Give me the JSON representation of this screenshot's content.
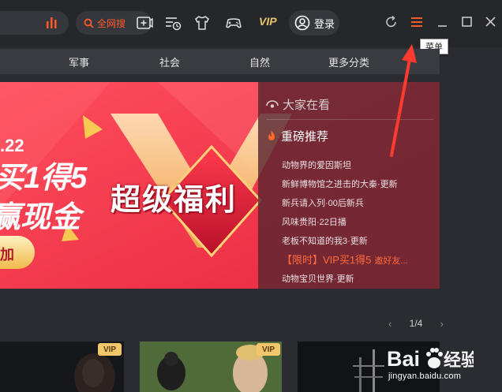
{
  "toolbar": {
    "search_all_label": "全网搜",
    "vip_label": "VIP",
    "login_label": "登录",
    "tooltip_menu": "菜单",
    "accent": "#ff5a2a"
  },
  "categories": [
    "军事",
    "社会",
    "自然",
    "更多分类"
  ],
  "banner": {
    "headline": "超级福利",
    "date_fragment": ".22",
    "line1": "买1得5",
    "line2": "赢现金",
    "button_fragment": "加"
  },
  "side_panel": {
    "watching_title": "大家在看",
    "featured_title": "重磅推荐",
    "items": [
      "动物界的爱因斯坦",
      "新鲜博物馆之进击的大秦·更新",
      "新兵请入列·00后新兵",
      "风味贵阳·22日播",
      "老板不知道的我3·更新"
    ],
    "promo_main": "【限时】VIP买1得5",
    "promo_sub": "邀好友...",
    "last_item": "动物宝贝世界·更新"
  },
  "pager": {
    "current": "1",
    "total": "4",
    "text": "1/4"
  },
  "thumbs": {
    "vip_badge": "VIP"
  },
  "watermark": {
    "logo_text": "Bai经验",
    "url": "jingyan.baidu.com"
  }
}
